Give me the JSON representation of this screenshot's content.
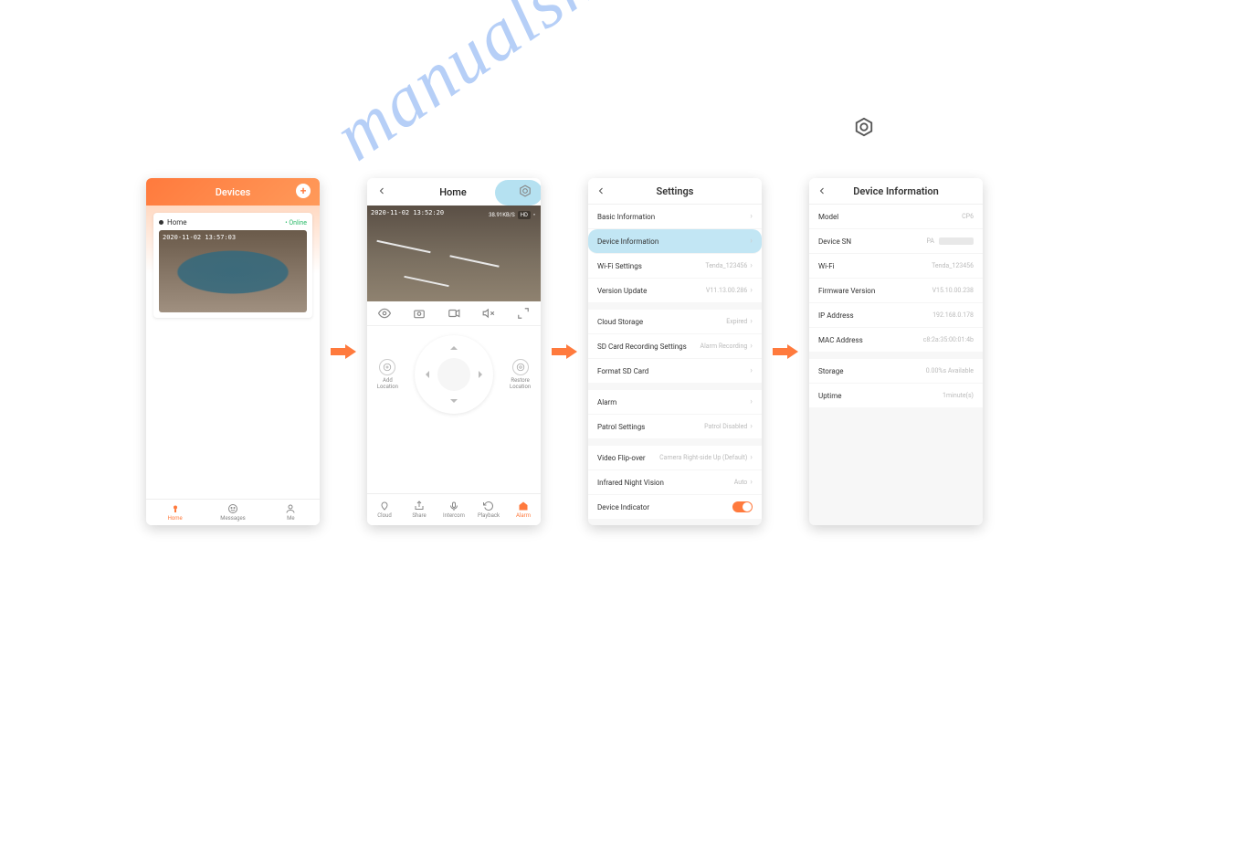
{
  "watermark": "manualshive.com",
  "arrow_color": "#ff7a3d",
  "screen1": {
    "header_title": "Devices",
    "card_name": "Home",
    "status": "• Online",
    "timestamp": "2020-11-02 13:57:03",
    "tabs": [
      {
        "label": "Home",
        "active": true
      },
      {
        "label": "Messages",
        "active": false
      },
      {
        "label": "Me",
        "active": false
      }
    ]
  },
  "screen2": {
    "title": "Home",
    "timestamp": "2020-11-02 13:52:20",
    "bitrate": "38.91KB/S",
    "quality": "HD",
    "add_loc": "Add\nLocation",
    "restore_loc": "Restore\nLocation",
    "tabs": [
      "Cloud",
      "Share",
      "Intercom",
      "Playback",
      "Alarm"
    ],
    "active_tab": 4
  },
  "screen3": {
    "title": "Settings",
    "groups": [
      [
        {
          "label": "Basic Information",
          "value": "",
          "chev": true
        },
        {
          "label": "Device Information",
          "value": "",
          "chev": true,
          "highlight": true
        },
        {
          "label": "Wi-Fi Settings",
          "value": "Tenda_123456",
          "chev": true
        },
        {
          "label": "Version Update",
          "value": "V11.13.00.286",
          "chev": true
        }
      ],
      [
        {
          "label": "Cloud Storage",
          "value": "Expired",
          "chev": true
        },
        {
          "label": "SD Card Recording Settings",
          "value": "Alarm Recording",
          "chev": true
        },
        {
          "label": "Format SD Card",
          "value": "",
          "chev": true
        }
      ],
      [
        {
          "label": "Alarm",
          "value": "",
          "chev": true
        },
        {
          "label": "Patrol Settings",
          "value": "Patrol Disabled",
          "chev": true
        }
      ],
      [
        {
          "label": "Video Flip-over",
          "value": "Camera Right-side Up (Default)",
          "chev": true
        },
        {
          "label": "Infrared Night Vision",
          "value": "Auto",
          "chev": true
        },
        {
          "label": "Device Indicator",
          "value": "",
          "toggle": true
        }
      ]
    ]
  },
  "screen4": {
    "title": "Device Information",
    "groups": [
      [
        {
          "label": "Model",
          "value": "CP6"
        },
        {
          "label": "Device SN",
          "value": "PA",
          "blur": true
        },
        {
          "label": "Wi-Fi",
          "value": "Tenda_123456"
        },
        {
          "label": "Firmware Version",
          "value": "V15.10.00.238"
        },
        {
          "label": "IP Address",
          "value": "192.168.0.178"
        },
        {
          "label": "MAC Address",
          "value": "c8:2a:35:00:01:4b"
        }
      ],
      [
        {
          "label": "Storage",
          "value": "0.00%s Available"
        },
        {
          "label": "Uptime",
          "value": "1minute(s)"
        }
      ]
    ]
  }
}
